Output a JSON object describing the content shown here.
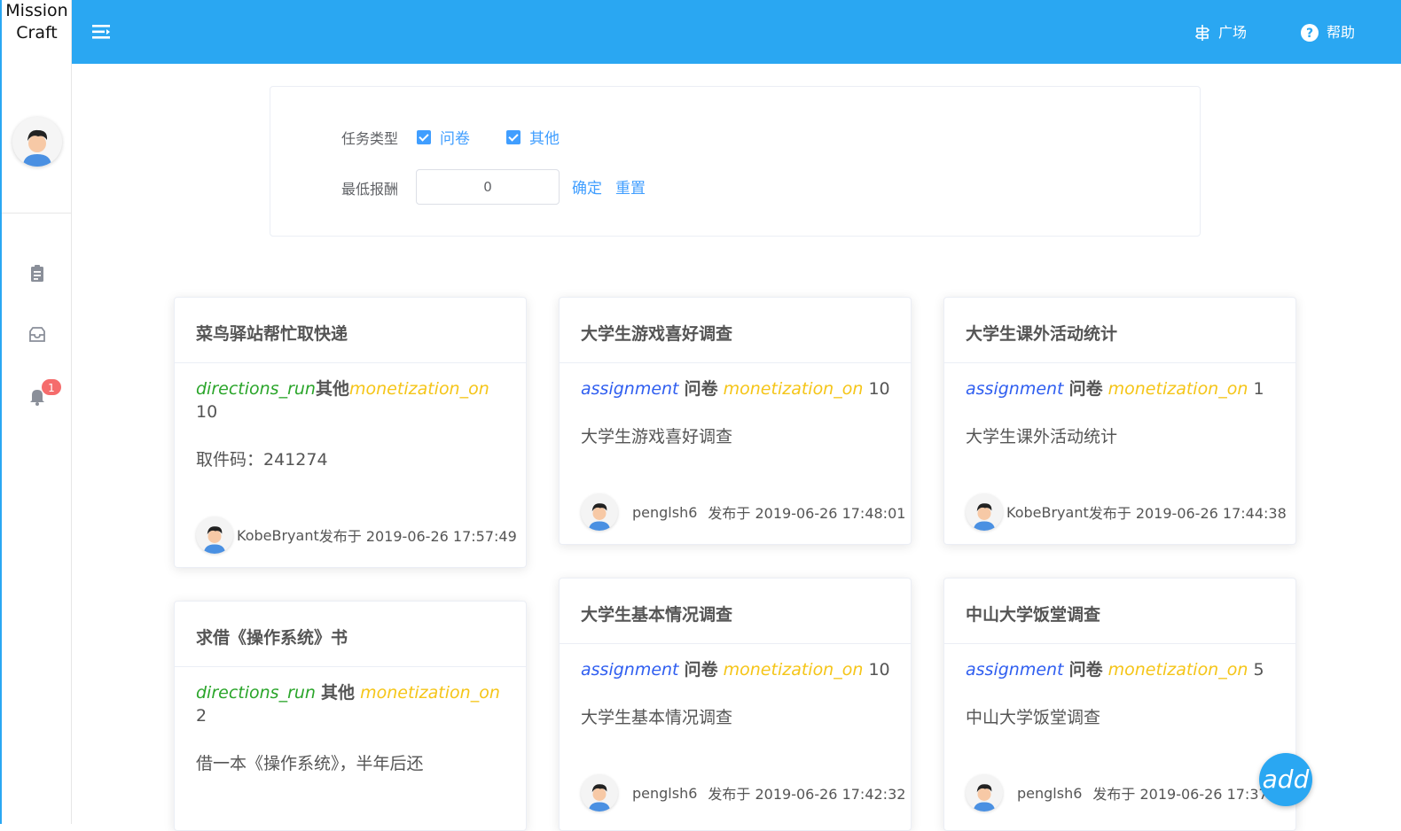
{
  "app": {
    "brand_line1": "Mission",
    "brand_line2": "Craft"
  },
  "header": {
    "nav": [
      {
        "label": "广场",
        "icon": "square-icon"
      },
      {
        "label": "帮助",
        "icon": "help-icon"
      }
    ]
  },
  "sidebar": {
    "items": [
      {
        "icon": "clipboard-icon"
      },
      {
        "icon": "inbox-icon"
      },
      {
        "icon": "bell-icon",
        "badge": "1"
      }
    ]
  },
  "filter": {
    "type_label": "任务类型",
    "options": [
      {
        "label": "问卷",
        "checked": true
      },
      {
        "label": "其他",
        "checked": true
      }
    ],
    "min_reward_label": "最低报酬",
    "min_reward_value": "0",
    "confirm_label": "确定",
    "reset_label": "重置"
  },
  "cards": [
    {
      "title": "菜鸟驿站帮忙取快递",
      "type_icon": "directions_run",
      "category": "其他",
      "pay_icon": "monetization_on",
      "reward": "10",
      "desc": "取件码：241274",
      "user": "KobeBryant",
      "published": "发布于 2019-06-26 17:57:49"
    },
    {
      "title": "大学生游戏喜好调查",
      "type_icon": "assignment",
      "category": "问卷",
      "pay_icon": "monetization_on",
      "reward": "10",
      "desc": "大学生游戏喜好调查",
      "user": "penglsh6",
      "published": "发布于 2019-06-26 17:48:01"
    },
    {
      "title": "大学生课外活动统计",
      "type_icon": "assignment",
      "category": "问卷",
      "pay_icon": "monetization_on",
      "reward": "1",
      "desc": "大学生课外活动统计",
      "user": "KobeBryant",
      "published": "发布于 2019-06-26 17:44:38"
    },
    {
      "title": "求借《操作系统》书",
      "type_icon": "directions_run",
      "category": "其他",
      "pay_icon": "monetization_on",
      "reward": "2",
      "desc": "借一本《操作系统》，半年后还",
      "user": "",
      "published": ""
    },
    {
      "title": "大学生基本情况调查",
      "type_icon": "assignment",
      "category": "问卷",
      "pay_icon": "monetization_on",
      "reward": "10",
      "desc": "大学生基本情况调查",
      "user": "penglsh6",
      "published": "发布于 2019-06-26 17:42:32"
    },
    {
      "title": "中山大学饭堂调查",
      "type_icon": "assignment",
      "category": "问卷",
      "pay_icon": "monetization_on",
      "reward": "5",
      "desc": "中山大学饭堂调查",
      "user": "penglsh6",
      "published": "发布于 2019-06-26 17:37:2"
    }
  ],
  "fab": {
    "label": "add"
  },
  "colors": {
    "primary": "#2aa7f2",
    "link": "#409eff",
    "badge": "#f56c6c"
  }
}
